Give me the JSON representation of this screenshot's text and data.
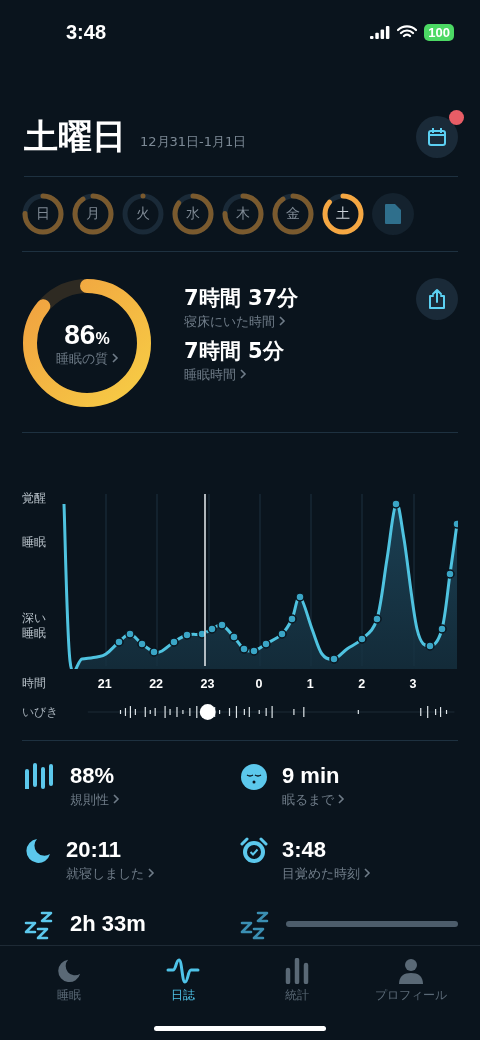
{
  "status_bar": {
    "time": "3:48",
    "battery": "100"
  },
  "header": {
    "title": "土曜日",
    "date_range": "12月31日-1月1日",
    "calendar_badge": true
  },
  "days": [
    {
      "label": "日",
      "selected": false
    },
    {
      "label": "月",
      "selected": false
    },
    {
      "label": "火",
      "selected": false
    },
    {
      "label": "水",
      "selected": false
    },
    {
      "label": "木",
      "selected": false
    },
    {
      "label": "金",
      "selected": false
    },
    {
      "label": "土",
      "selected": true
    }
  ],
  "summary": {
    "quality": {
      "value": "86",
      "unit": "%",
      "label": "睡眠の質"
    },
    "stats": [
      {
        "value": "7時間 37分",
        "label": "寝床にいた時間"
      },
      {
        "value": "7時間 5分",
        "label": "睡眠時間"
      }
    ]
  },
  "hypnogram": {
    "y_labels": [
      "覚醒",
      "睡眠",
      "深い睡眠"
    ],
    "x_title": "時間",
    "x_labels": [
      "21",
      "22",
      "23",
      "0",
      "1",
      "2",
      "3"
    ],
    "snore_label": "いびき"
  },
  "metrics": [
    {
      "kind": "bars",
      "value": "88%",
      "label": "規則性"
    },
    {
      "kind": "face",
      "value": "9 min",
      "label": "眠るまで"
    },
    {
      "kind": "moon",
      "value": "20:11",
      "label": "就寝しました"
    },
    {
      "kind": "alarm",
      "value": "3:48",
      "label": "目覚めた時刻"
    },
    {
      "kind": "zzz",
      "value": "2h 33m"
    },
    {
      "kind": "zzz-loading"
    }
  ],
  "tabs": [
    {
      "label": "睡眠",
      "kind": "moon",
      "selected": false
    },
    {
      "label": "日誌",
      "kind": "wave",
      "selected": true
    },
    {
      "label": "統計",
      "kind": "stats",
      "selected": false
    },
    {
      "label": "プロフィール",
      "kind": "person",
      "selected": false
    }
  ]
}
